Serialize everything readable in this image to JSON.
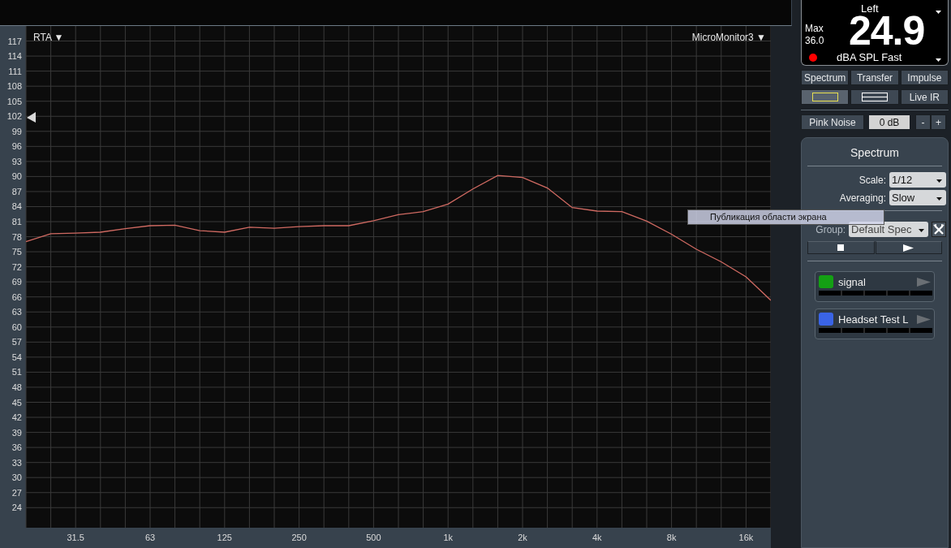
{
  "analyzer": {
    "mode_menu": "RTA ▼",
    "device_menu": "MicroMonitor3 ▼",
    "chart_data": {
      "type": "line",
      "categories": [
        null,
        null,
        "31.5",
        null,
        null,
        "63",
        null,
        null,
        "125",
        null,
        null,
        "250",
        null,
        null,
        "500",
        null,
        null,
        "1k",
        null,
        null,
        "2k",
        null,
        null,
        "4k",
        null,
        null,
        "8k",
        null,
        null,
        "16k",
        null
      ],
      "series": [
        {
          "color": "#d06a62",
          "values": [
            77,
            78.6,
            78.7,
            78.9,
            79.6,
            80.2,
            80.3,
            79.2,
            78.9,
            79.9,
            79.7,
            80,
            80.2,
            80.2,
            81.2,
            82.4,
            83,
            84.5,
            87.5,
            90.2,
            89.8,
            87.7,
            83.8,
            83.1,
            83,
            81.1,
            78.5,
            75.5,
            73,
            70,
            65.3
          ]
        }
      ],
      "ylim": [
        20,
        120
      ],
      "grid": true,
      "yticks": [
        117,
        114,
        111,
        108,
        105,
        102,
        99,
        96,
        93,
        90,
        87,
        84,
        81,
        78,
        75,
        72,
        69,
        66,
        63,
        60,
        57,
        54,
        51,
        48,
        45,
        42,
        39,
        36,
        33,
        30,
        27,
        24
      ]
    }
  },
  "meter": {
    "channel": "Left",
    "value": "24.9",
    "max_label": "Max",
    "max_value": "36.0",
    "unit": "dBA SPL Fast",
    "recording": true
  },
  "view_tabs": [
    "Spectrum",
    "Transfer",
    "Impulse"
  ],
  "layout_buttons": [
    {
      "kind": "single",
      "selected": true
    },
    {
      "kind": "split",
      "selected": false
    },
    {
      "kind": "text",
      "label": "Live IR",
      "selected": false
    }
  ],
  "generator": {
    "button": "Pink Noise",
    "value": "0 dB",
    "minus": "-",
    "plus": "+"
  },
  "spectrum_panel": {
    "title": "Spectrum",
    "scale": {
      "label": "Scale:",
      "value": "1/12"
    },
    "averaging": {
      "label": "Averaging:",
      "value": "Slow"
    },
    "group": {
      "label": "Group:",
      "value": "Default Spec"
    }
  },
  "measurements": [
    {
      "name": "signal",
      "color": "#14a014"
    },
    {
      "name": "Headset Test L",
      "color": "#3a64e6"
    }
  ],
  "tooltip": "Публикация области экрана"
}
